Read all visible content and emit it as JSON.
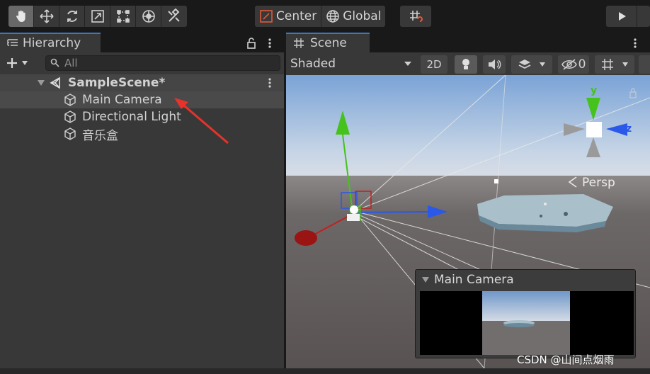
{
  "toolbar": {
    "tools": [
      {
        "name": "hand-tool",
        "active": true
      },
      {
        "name": "move-tool"
      },
      {
        "name": "rotate-tool"
      },
      {
        "name": "scale-tool"
      },
      {
        "name": "rect-tool"
      },
      {
        "name": "transform-tool"
      },
      {
        "name": "custom-tool"
      }
    ],
    "pivot_label": "Center",
    "space_label": "Global"
  },
  "hierarchy": {
    "tab_label": "Hierarchy",
    "search_placeholder": "All",
    "scene_name": "SampleScene*",
    "items": [
      {
        "label": "Main Camera",
        "selected": true
      },
      {
        "label": "Directional Light"
      },
      {
        "label": "音乐盒"
      }
    ]
  },
  "scene": {
    "tab_label": "Scene",
    "shading_mode": "Shaded",
    "mode_2d": "2D",
    "hidden_count": "0",
    "gizmo_axes": {
      "y": "y",
      "z": "z"
    },
    "persp_label": "Persp"
  },
  "camera_preview": {
    "title": "Main Camera"
  },
  "watermark": "CSDN @山间点烟雨",
  "colors": {
    "accent": "#3a79bb",
    "axis_x": "#c02020",
    "axis_y": "#46c21c",
    "axis_z": "#2a58e8",
    "annotation_arrow": "#e8322a"
  }
}
